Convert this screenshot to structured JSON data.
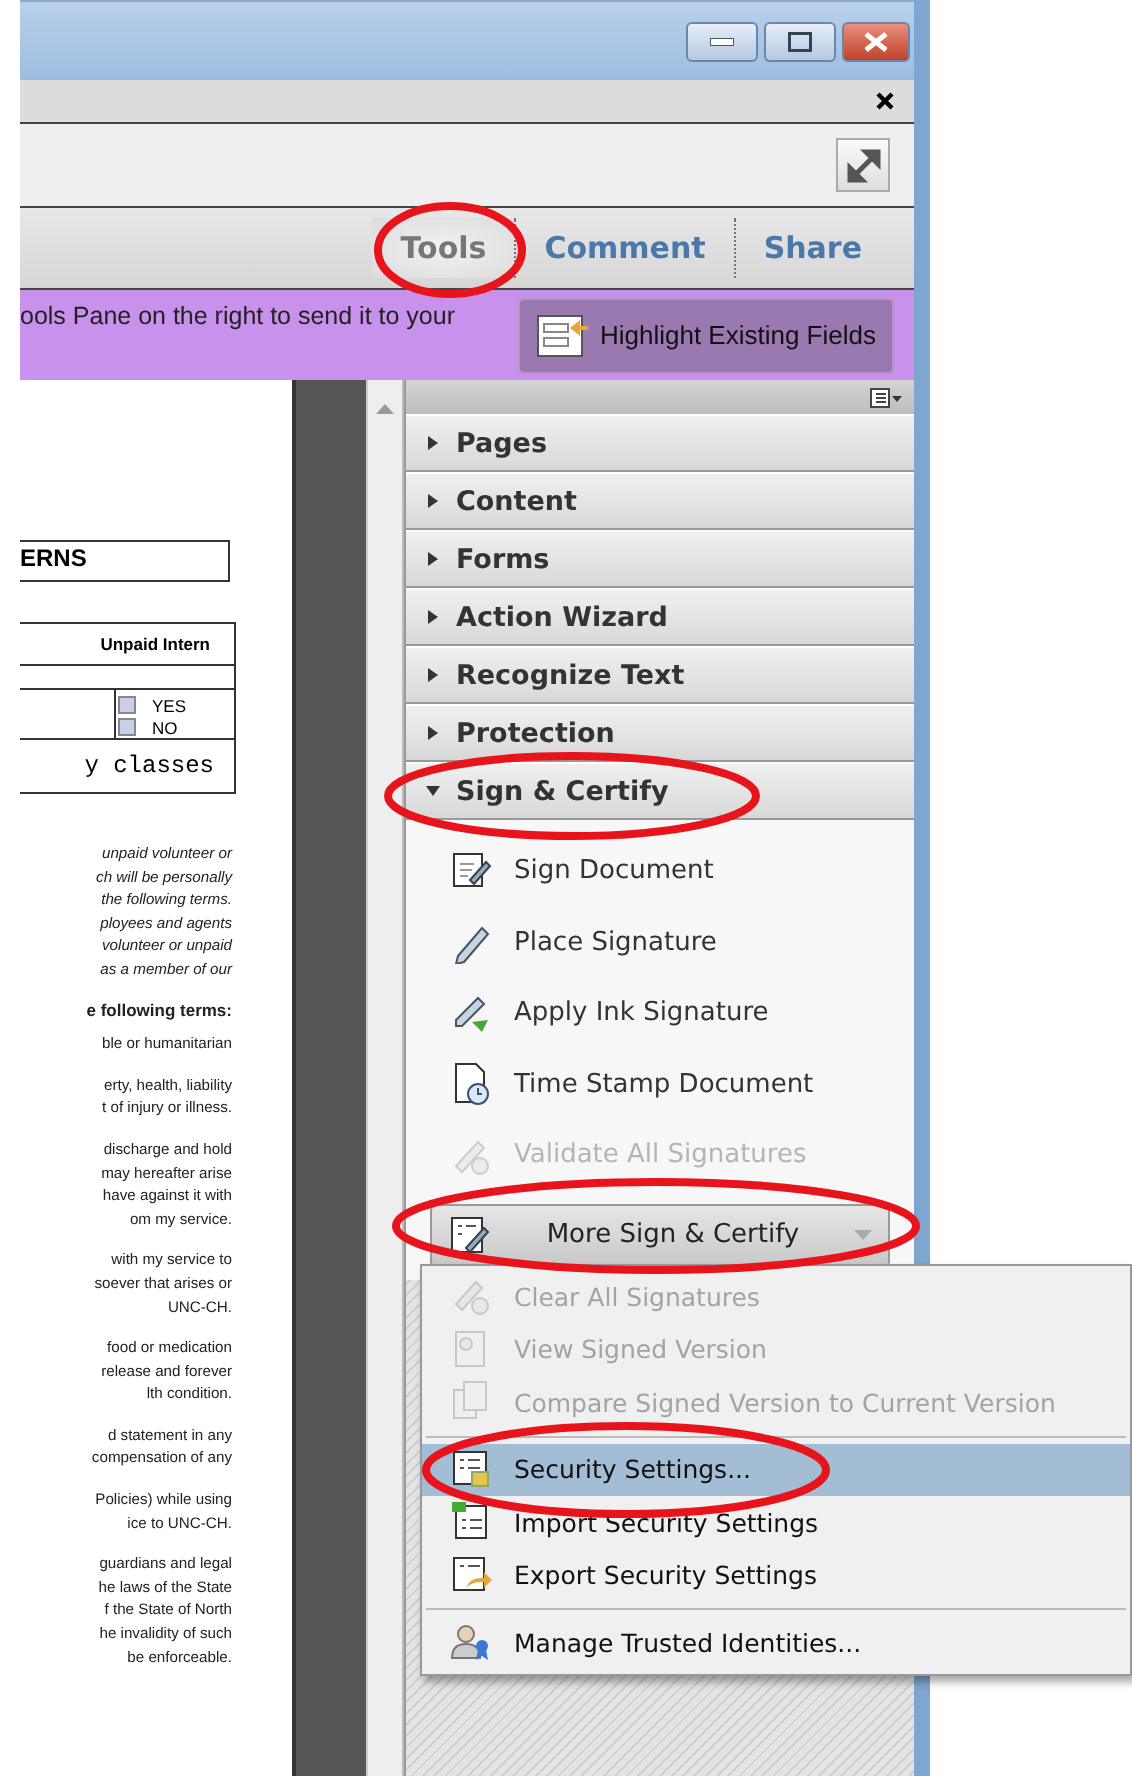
{
  "tabs": [
    {
      "label": "Tools",
      "selected": true
    },
    {
      "label": "Comment",
      "selected": false
    },
    {
      "label": "Share",
      "selected": false
    }
  ],
  "notice": {
    "text": "ools Pane on the right to send it to your",
    "button": "Highlight Existing Fields"
  },
  "document": {
    "heading": "ERNS",
    "table": {
      "header": "Unpaid Intern",
      "options": [
        {
          "label": "YES",
          "checked": false
        },
        {
          "label": "NO",
          "checked": false
        }
      ],
      "entry": "y classes"
    },
    "paragraphs": [
      {
        "kind": "italic",
        "text": "unpaid volunteer or\nch will be personally\nthe following terms.\nployees and agents\nvolunteer or unpaid\nas a member of our"
      },
      {
        "kind": "bold",
        "text": "e following terms:"
      },
      {
        "kind": "plain",
        "text": "ble or humanitarian"
      },
      {
        "kind": "plain",
        "text": "erty, health, liability\nt of injury or illness."
      },
      {
        "kind": "plain",
        "text": "discharge and hold\nmay hereafter arise\nhave against it with\nom my service."
      },
      {
        "kind": "plain",
        "text": "with my service to\nsoever that arises or\nUNC-CH."
      },
      {
        "kind": "plain",
        "text": "food or medication\nrelease and forever\nlth condition."
      },
      {
        "kind": "plain",
        "text": "d statement in any\ncompensation of any"
      },
      {
        "kind": "plain",
        "text": "Policies) while using\nice to UNC-CH."
      },
      {
        "kind": "plain",
        "text": "guardians and legal\nhe laws of the State\nf the State of North\nhe invalidity of such\nbe enforceable."
      }
    ]
  },
  "panel": {
    "sections": [
      {
        "label": "Pages",
        "expanded": false
      },
      {
        "label": "Content",
        "expanded": false
      },
      {
        "label": "Forms",
        "expanded": false
      },
      {
        "label": "Action Wizard",
        "expanded": false
      },
      {
        "label": "Recognize Text",
        "expanded": false
      },
      {
        "label": "Protection",
        "expanded": false
      },
      {
        "label": "Sign & Certify",
        "expanded": true,
        "items": [
          {
            "label": "Sign Document",
            "disabled": false
          },
          {
            "label": "Place Signature",
            "disabled": false
          },
          {
            "label": "Apply Ink Signature",
            "disabled": false
          },
          {
            "label": "Time Stamp Document",
            "disabled": false
          },
          {
            "label": "Validate All Signatures",
            "disabled": true
          }
        ],
        "more_button": "More Sign & Certify"
      }
    ]
  },
  "menu": {
    "groups": [
      [
        {
          "label": "Clear All Signatures",
          "disabled": true,
          "selected": false
        },
        {
          "label": "View Signed Version",
          "disabled": true,
          "selected": false
        },
        {
          "label": "Compare Signed Version to Current Version",
          "disabled": true,
          "selected": false
        }
      ],
      [
        {
          "label": "Security Settings...",
          "disabled": false,
          "selected": true
        },
        {
          "label": "Import Security Settings",
          "disabled": false,
          "selected": false
        },
        {
          "label": "Export Security Settings",
          "disabled": false,
          "selected": false
        }
      ],
      [
        {
          "label": "Manage Trusted Identities...",
          "disabled": false,
          "selected": false
        }
      ]
    ]
  }
}
